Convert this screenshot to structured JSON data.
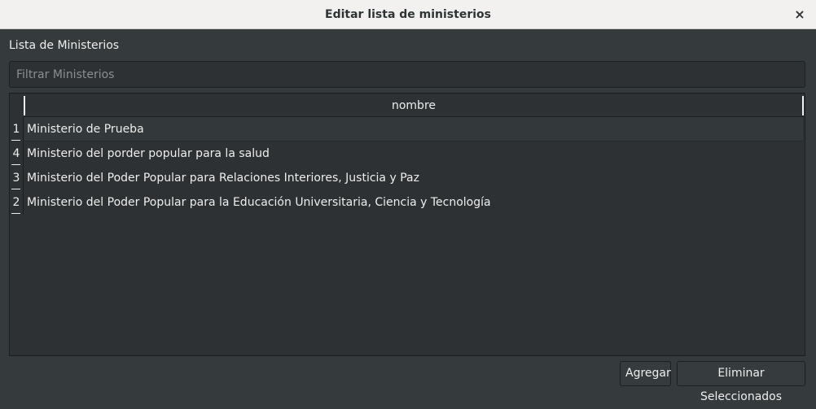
{
  "window": {
    "title": "Editar lista de ministerios",
    "close_glyph": "×"
  },
  "section": {
    "label": "Lista de Ministerios"
  },
  "filter": {
    "placeholder": "Filtrar Ministerios",
    "value": ""
  },
  "table": {
    "column": "nombre",
    "rows": [
      {
        "id": "1",
        "nombre": "Ministerio de Prueba"
      },
      {
        "id": "4",
        "nombre": "Ministerio del porder popular para la salud"
      },
      {
        "id": "3",
        "nombre": "Ministerio del Poder Popular para Relaciones Interiores, Justicia y Paz"
      },
      {
        "id": "2",
        "nombre": "Ministerio del Poder Popular para la Educación Universitaria, Ciencia y Tecnología"
      }
    ]
  },
  "buttons": {
    "add": "Agregar",
    "delete_selected": "Eliminar Seleccionados"
  },
  "colors": {
    "background": "#353a3d",
    "titlebar": "#f2f1f0",
    "text": "#eeeeec",
    "field": "#2d3134"
  },
  "icons": {
    "close": "close-icon"
  }
}
